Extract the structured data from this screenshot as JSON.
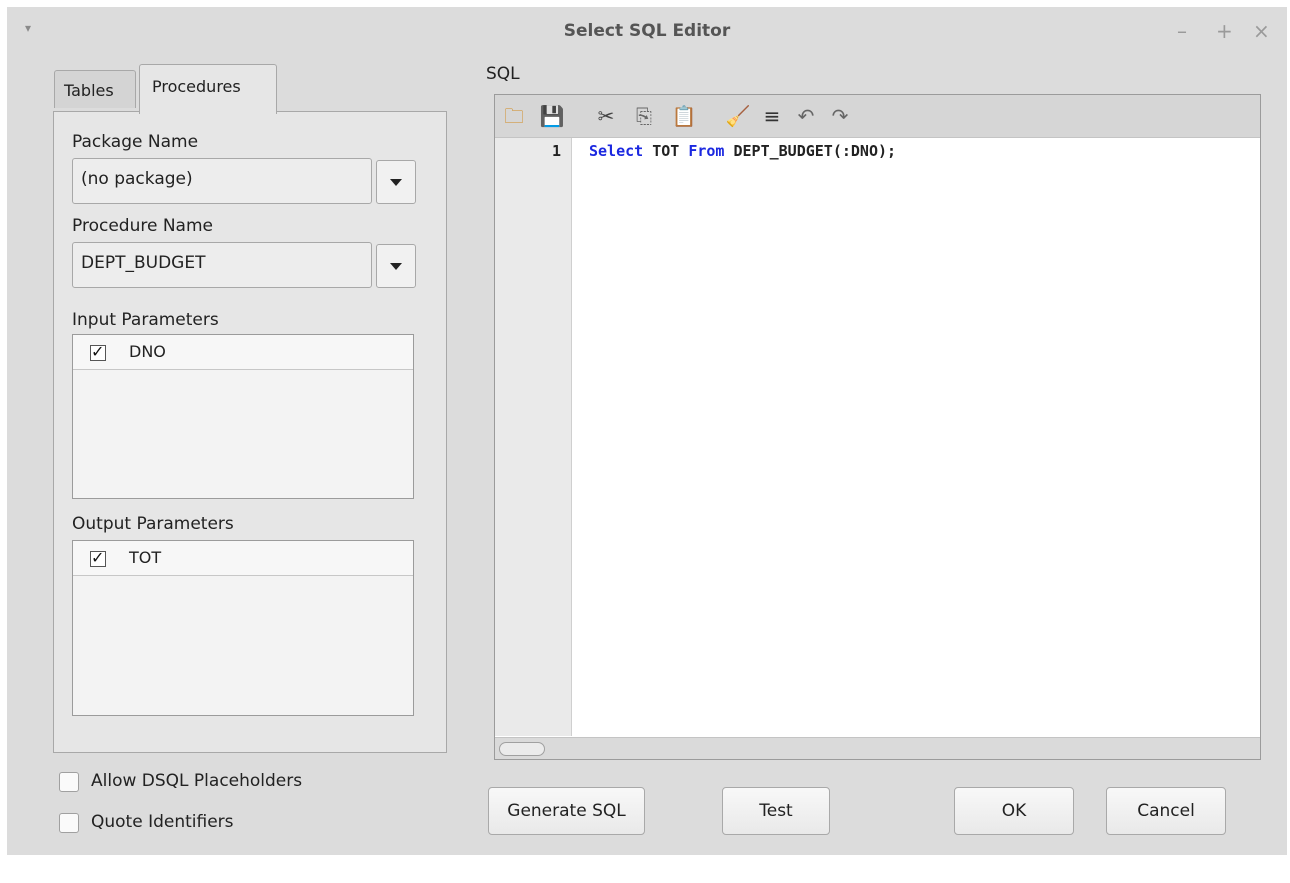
{
  "window": {
    "title": "Select SQL Editor",
    "menu_glyph": "▾",
    "minimize_glyph": "–",
    "maximize_glyph": "+",
    "close_glyph": "×"
  },
  "tabs": [
    {
      "label": "Tables",
      "active": false
    },
    {
      "label": "Procedures",
      "active": true
    }
  ],
  "procedures": {
    "package_label": "Package Name",
    "package_value": "(no package)",
    "procedure_label": "Procedure Name",
    "procedure_value": "DEPT_BUDGET",
    "input_label": "Input Parameters",
    "input_params": [
      {
        "name": "DNO",
        "checked": true
      }
    ],
    "output_label": "Output Parameters",
    "output_params": [
      {
        "name": "TOT",
        "checked": true
      }
    ]
  },
  "options": {
    "allow_dsql": {
      "label": "Allow DSQL Placeholders",
      "checked": false
    },
    "quote_identifiers": {
      "label": "Quote Identifiers",
      "checked": false
    }
  },
  "sql": {
    "label": "SQL",
    "line_number": "1",
    "code_keyword1": "Select",
    "code_part1": " TOT ",
    "code_keyword2": "From",
    "code_part2": " DEPT_BUDGET(:DNO);",
    "toolbar_icons": [
      "open-file-icon",
      "save-file-icon",
      "cut-icon",
      "copy-icon",
      "paste-icon",
      "clear-icon",
      "format-icon",
      "undo-icon",
      "redo-icon"
    ]
  },
  "buttons": {
    "generate": "Generate SQL",
    "test": "Test",
    "ok": "OK",
    "cancel": "Cancel"
  },
  "colors": {
    "keyword": "#1b28e0",
    "window_bg": "#dcdcdc"
  }
}
